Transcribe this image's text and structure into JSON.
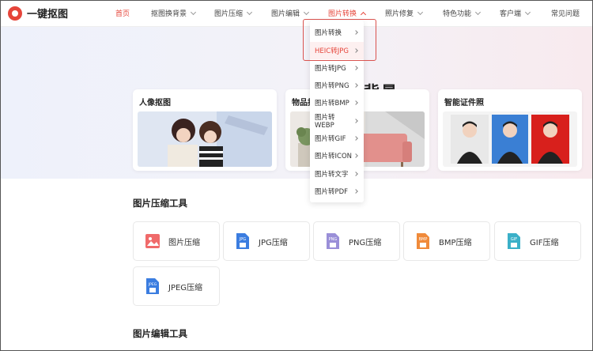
{
  "brand": {
    "name": "一键抠图"
  },
  "nav": {
    "home": "首页",
    "bg": "抠图换背景",
    "compress": "图片压缩",
    "edit": "图片编辑",
    "convert": "图片转换",
    "repair": "照片修复",
    "features": "特色功能",
    "client": "客户端",
    "faq": "常见问题"
  },
  "hero": {
    "title_suffix": "背景",
    "cards": [
      {
        "title": "人像抠图"
      },
      {
        "title": "物品抠"
      },
      {
        "title": "智能证件照"
      }
    ]
  },
  "dropdown": {
    "items": [
      "图片转换",
      "HEIC转JPG",
      "图片转JPG",
      "图片转PNG",
      "图片转BMP",
      "图片转WEBP",
      "图片转GIF",
      "图片转ICON",
      "图片转文字",
      "图片转PDF"
    ]
  },
  "sections": {
    "compress_title": "图片压缩工具",
    "edit_title": "图片编辑工具"
  },
  "tools": [
    {
      "label": "图片压缩",
      "badge": ""
    },
    {
      "label": "JPG压缩",
      "badge": "JPG"
    },
    {
      "label": "PNG压缩",
      "badge": "PNG"
    },
    {
      "label": "BMP压缩",
      "badge": "BMP"
    },
    {
      "label": "GIF压缩",
      "badge": "GIF"
    },
    {
      "label": "JPEG压缩",
      "badge": "JPEG"
    }
  ],
  "colors": {
    "accent": "#e6453a"
  }
}
